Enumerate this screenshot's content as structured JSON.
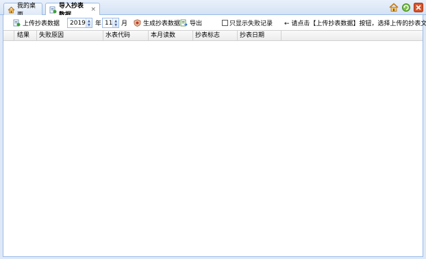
{
  "tabs": [
    {
      "label": "我的桌面",
      "icon": "home-icon"
    },
    {
      "label": "导入抄表数据",
      "icon": "import-icon",
      "close": "×"
    }
  ],
  "top_icons": [
    "home-icon",
    "refresh-icon",
    "close-icon"
  ],
  "toolbar": {
    "upload_label": "上传抄表数据",
    "year_value": "2019",
    "year_unit": "年",
    "month_value": "11",
    "month_unit": "月",
    "generate_label": "生成抄表数据",
    "export_label": "导出",
    "only_failed_label": "只显示失败记录",
    "only_failed_checked": false,
    "hint": "← 请点击【上传抄表数据】按钮，选择上传的抄表文件!"
  },
  "grid": {
    "columns": [
      "结果",
      "失败原因",
      "水表代码",
      "本月读数",
      "抄表标志",
      "抄表日期"
    ],
    "rows": []
  }
}
